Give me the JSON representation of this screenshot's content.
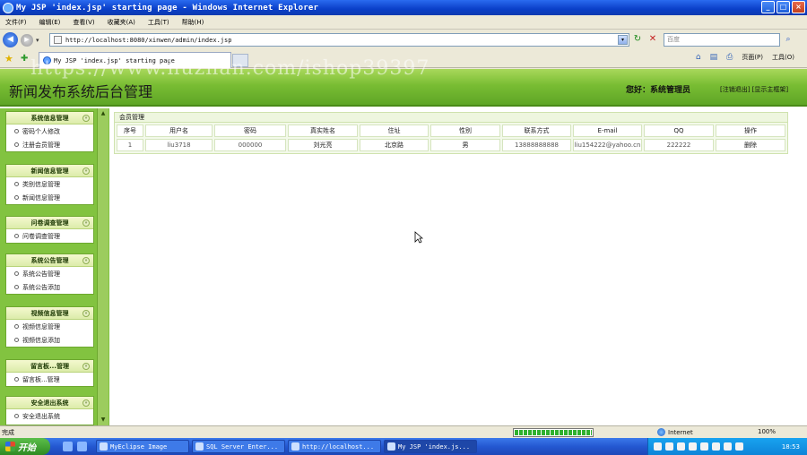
{
  "window": {
    "title": "My JSP 'index.jsp' starting page - Windows Internet Explorer",
    "controls": [
      "_",
      "□",
      "×"
    ]
  },
  "menubar": [
    "文件(F)",
    "编辑(E)",
    "查看(V)",
    "收藏夹(A)",
    "工具(T)",
    "帮助(H)"
  ],
  "address": {
    "url": "http://localhost:8080/xinwen/admin/index.jsp",
    "search_placeholder": "百度"
  },
  "tab": {
    "label": "My JSP 'index.jsp' starting page"
  },
  "commandbar": {
    "page": "页面(P)",
    "tools": "工具(O)"
  },
  "watermark": "https://www.huzhan.com/ishop39397",
  "header": {
    "title": "新闻发布系统后台管理",
    "greeting": "您好：系统管理员",
    "links": "[注销退出] [显示主框架]"
  },
  "sidebar": {
    "groups": [
      {
        "title": "系统信息管理",
        "items": [
          "密码个人修改",
          "注册会员管理"
        ]
      },
      {
        "title": "新闻信息管理",
        "items": [
          "类别信息管理",
          "新闻信息管理"
        ]
      },
      {
        "title": "问卷调查管理",
        "items": [
          "问卷调查管理"
        ]
      },
      {
        "title": "系统公告管理",
        "items": [
          "系统公告管理",
          "系统公告添加"
        ]
      },
      {
        "title": "视频信息管理",
        "items": [
          "视频信息管理",
          "视频信息添加"
        ]
      },
      {
        "title": "留言板...管理",
        "items": [
          "留言板...管理"
        ]
      },
      {
        "title": "安全退出系统",
        "items": [
          "安全退出系统"
        ]
      }
    ]
  },
  "content": {
    "panel_title": "会员管理",
    "columns": [
      "序号",
      "用户名",
      "密码",
      "真实姓名",
      "住址",
      "性别",
      "联系方式",
      "E-mail",
      "QQ",
      "操作"
    ],
    "rows": [
      [
        "1",
        "liu3718",
        "000000",
        "刘光亮",
        "北京路",
        "男",
        "13888888888",
        "liu154222@yahoo.cn",
        "222222",
        "删除"
      ]
    ]
  },
  "statusbar": {
    "left": "完成",
    "zone": "Internet",
    "zoom": "100%",
    "progress": 1.0
  },
  "taskbar": {
    "start": "开始",
    "tasks": [
      "MyEclipse Image",
      "SQL Server Enter...",
      "http://localhost...",
      "My JSP 'index.js..."
    ],
    "clock": "18:53"
  }
}
